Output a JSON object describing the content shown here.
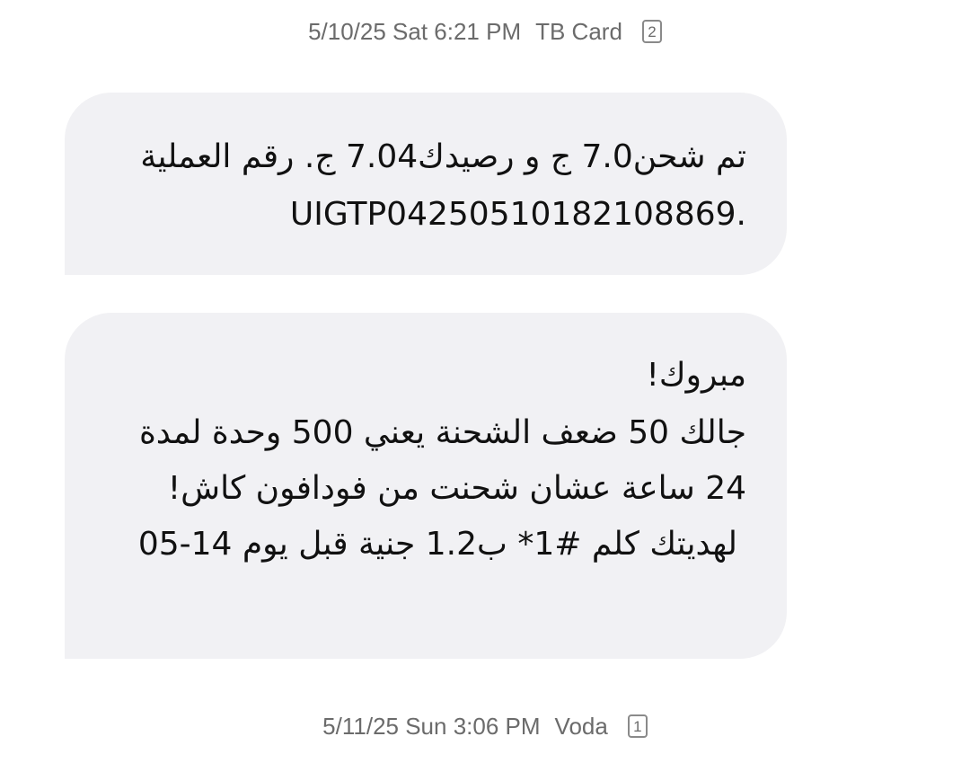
{
  "conversation": {
    "messages": [
      {
        "date_line": "5/10/25 Sat 6:21 PM",
        "sender": "TB Card",
        "sim": "2",
        "lines": [
          "تم شحن7.0 ج و رصيدك7.04 ج. رقم العملية",
          "UIGTP04250510182108869."
        ]
      },
      {
        "lines": [
          "مبروك!",
          "جالك 50 ضعف الشحنة يعني 500 وحدة لمدة",
          "24 ساعة عشان شحنت من فودافون كاش!",
          "لهديتك كلم #1* ب1.2 جنية قبل يوم 14-05"
        ]
      }
    ],
    "next_header": {
      "date_line": "5/11/25 Sun 3:06 PM",
      "sender": "Voda",
      "sim": "1"
    }
  }
}
